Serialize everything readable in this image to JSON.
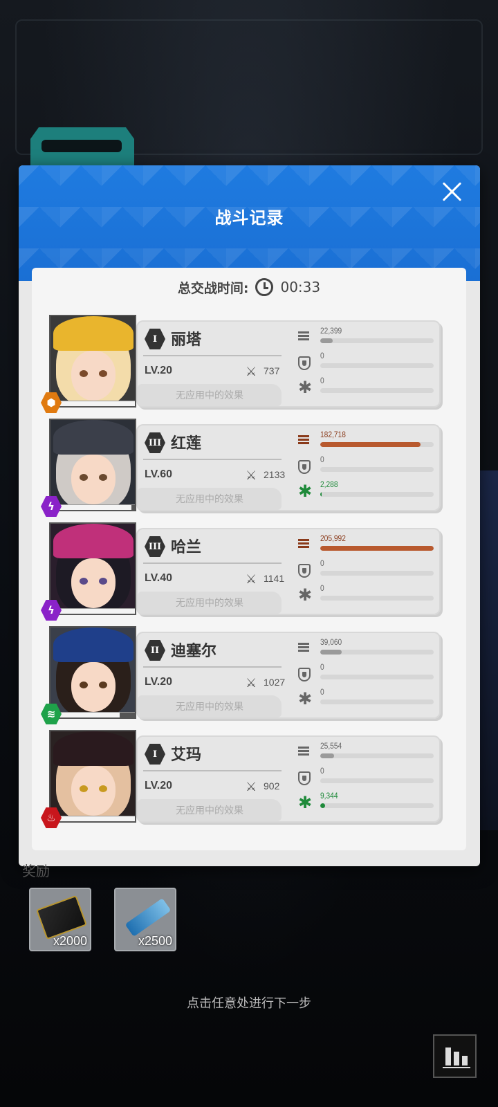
{
  "dialog": {
    "title": "战斗记录",
    "battle_time_label": "总交战时间:",
    "battle_time_value": "00:33",
    "no_effect_text": "无应用中的效果"
  },
  "characters": [
    {
      "rank": "I",
      "name": "丽塔",
      "level": "LV.20",
      "power": "737",
      "element": "hive-icon",
      "element_color": "#e07a10",
      "damage": "22,399",
      "damage_frac": 0.109,
      "shield": "0",
      "shield_frac": 0,
      "heal": "0",
      "heal_frac": 0
    },
    {
      "rank": "III",
      "name": "红莲",
      "level": "LV.60",
      "power": "2133",
      "element": "electric-icon",
      "element_color": "#8a22c8",
      "damage": "182,718",
      "damage_frac": 0.887,
      "shield": "0",
      "shield_frac": 0,
      "heal": "2,288",
      "heal_frac": 0.012
    },
    {
      "rank": "III",
      "name": "哈兰",
      "level": "LV.40",
      "power": "1141",
      "element": "electric-icon",
      "element_color": "#8a22c8",
      "damage": "205,992",
      "damage_frac": 1.0,
      "shield": "0",
      "shield_frac": 0,
      "heal": "0",
      "heal_frac": 0
    },
    {
      "rank": "II",
      "name": "迪塞尔",
      "level": "LV.20",
      "power": "1027",
      "element": "wind-icon",
      "element_color": "#1fa24a",
      "damage": "39,060",
      "damage_frac": 0.19,
      "shield": "0",
      "shield_frac": 0,
      "heal": "0",
      "heal_frac": 0
    },
    {
      "rank": "I",
      "name": "艾玛",
      "level": "LV.20",
      "power": "902",
      "element": "fire-icon",
      "element_color": "#c8161c",
      "damage": "25,554",
      "damage_frac": 0.124,
      "shield": "0",
      "shield_frac": 0,
      "heal": "9,344",
      "heal_frac": 0.045
    }
  ],
  "rewards": {
    "label": "奖励",
    "items": [
      {
        "name": "credit-card-icon",
        "qty": "x2000"
      },
      {
        "name": "usb-drive-icon",
        "qty": "x2500"
      }
    ]
  },
  "hint": "点击任意处进行下一步",
  "colors": {
    "header_blue": "#1f7be0",
    "damage_high": "#b8592e",
    "damage_low": "#9a9a9a",
    "heal_green": "#1f8a3a"
  }
}
